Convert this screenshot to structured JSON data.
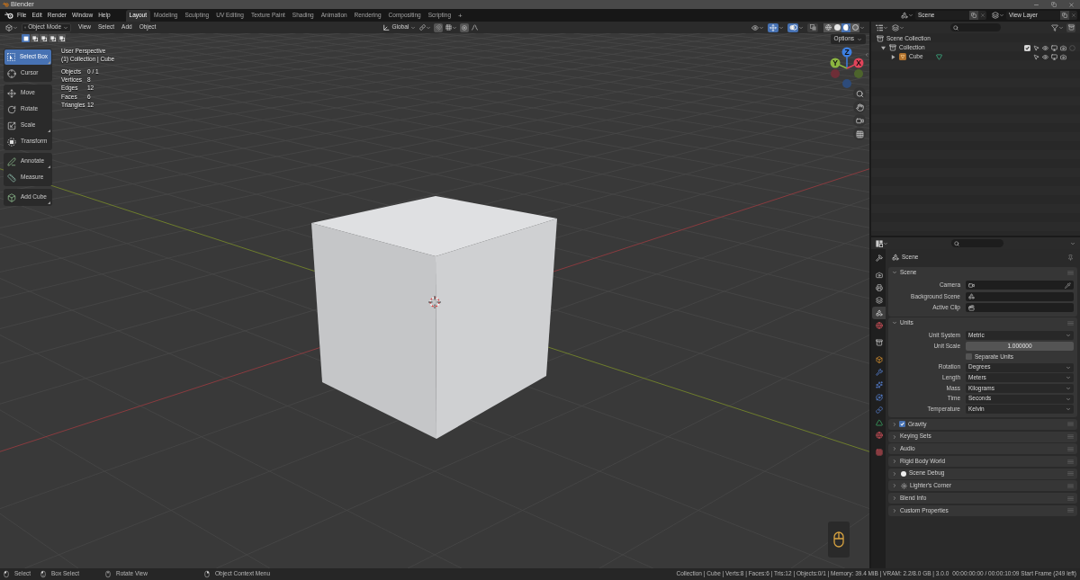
{
  "window": {
    "title": "Blender"
  },
  "topbar": {
    "menu": [
      "File",
      "Edit",
      "Render",
      "Window",
      "Help"
    ],
    "workspaces": [
      {
        "label": "Layout",
        "selected": true
      },
      {
        "label": "Modeling",
        "selected": false
      },
      {
        "label": "Sculpting",
        "selected": false
      },
      {
        "label": "UV Editing",
        "selected": false
      },
      {
        "label": "Texture Paint",
        "selected": false
      },
      {
        "label": "Shading",
        "selected": false
      },
      {
        "label": "Animation",
        "selected": false
      },
      {
        "label": "Rendering",
        "selected": false
      },
      {
        "label": "Compositing",
        "selected": false
      },
      {
        "label": "Scripting",
        "selected": false
      }
    ],
    "add_tab": "+",
    "scene": "Scene",
    "view_layer": "View Layer"
  },
  "viewport": {
    "header": {
      "mode": "Object Mode",
      "menus": [
        "View",
        "Select",
        "Add",
        "Object"
      ],
      "orientation": "Global",
      "toggles": [
        {
          "kind": "gizmo",
          "on": true
        },
        {
          "kind": "overlay",
          "on": true
        },
        {
          "kind": "xray",
          "on": false
        }
      ],
      "shading": [
        {
          "kind": "wireframe",
          "selected": false
        },
        {
          "kind": "solid",
          "selected": false
        },
        {
          "kind": "material",
          "selected": true
        },
        {
          "kind": "rendered",
          "selected": false
        }
      ]
    },
    "select_modes": [
      {
        "kind": "set",
        "selected": true
      },
      {
        "kind": "extend",
        "selected": false
      },
      {
        "kind": "subtract",
        "selected": false
      },
      {
        "kind": "invert",
        "selected": false
      },
      {
        "kind": "intersect",
        "selected": false
      }
    ],
    "options": "Options",
    "tool_groups": [
      {
        "tools": [
          {
            "kind": "select",
            "label": "Select Box",
            "selected": true,
            "more": true
          },
          {
            "kind": "cursor",
            "label": "Cursor",
            "selected": false,
            "more": false
          }
        ]
      },
      {
        "tools": [
          {
            "kind": "move",
            "label": "Move",
            "selected": false,
            "more": false
          },
          {
            "kind": "rotate",
            "label": "Rotate",
            "selected": false,
            "more": false
          },
          {
            "kind": "scale",
            "label": "Scale",
            "selected": false,
            "more": true
          },
          {
            "kind": "transform",
            "label": "Transform",
            "selected": false,
            "more": false
          }
        ]
      },
      {
        "tools": [
          {
            "kind": "annotate",
            "label": "Annotate",
            "selected": false,
            "more": true
          },
          {
            "kind": "measure",
            "label": "Measure",
            "selected": false,
            "more": false
          }
        ]
      },
      {
        "tools": [
          {
            "kind": "add",
            "label": "Add Cube",
            "selected": false,
            "more": true
          }
        ]
      }
    ],
    "view_name": "User Perspective",
    "context": "(1) Collection | Cube",
    "stats": [
      {
        "label": "Objects",
        "value": "0 / 1"
      },
      {
        "label": "Vertices",
        "value": "8"
      },
      {
        "label": "Edges",
        "value": "12"
      },
      {
        "label": "Faces",
        "value": "6"
      },
      {
        "label": "Triangles",
        "value": "12"
      }
    ],
    "gizmo_axes": [
      "Z",
      "Y",
      "X"
    ]
  },
  "outliner": {
    "tree": [
      {
        "kind": "scene_collection",
        "label": "Scene Collection",
        "children": [
          {
            "kind": "collection",
            "label": "Collection",
            "expanded": true,
            "checked": true,
            "children": [
              {
                "kind": "object",
                "label": "Cube",
                "expanded": false
              }
            ]
          }
        ]
      }
    ]
  },
  "properties": {
    "tab_groups": [
      {
        "tabs": [
          {
            "kind": "tool",
            "selected": false
          }
        ]
      },
      {
        "tabs": [
          {
            "kind": "render",
            "selected": false
          },
          {
            "kind": "output",
            "selected": false
          },
          {
            "kind": "view_layer",
            "selected": false
          },
          {
            "kind": "scene",
            "selected": true
          },
          {
            "kind": "world",
            "selected": false
          }
        ]
      },
      {
        "tabs": [
          {
            "kind": "collection",
            "selected": false
          }
        ]
      },
      {
        "tabs": [
          {
            "kind": "object",
            "selected": false
          },
          {
            "kind": "modifiers",
            "selected": false
          },
          {
            "kind": "particles",
            "selected": false
          },
          {
            "kind": "physics",
            "selected": false
          },
          {
            "kind": "constraints",
            "selected": false
          },
          {
            "kind": "data",
            "selected": false
          },
          {
            "kind": "material",
            "selected": false
          }
        ]
      },
      {
        "tabs": [
          {
            "kind": "texture",
            "selected": false
          }
        ]
      }
    ],
    "context": "Scene",
    "panels": [
      {
        "title": "Scene",
        "kind": "plain",
        "expanded": true,
        "rows": [
          {
            "label": "Camera",
            "kind": "camera"
          },
          {
            "label": "Background Scene",
            "kind": "scene"
          },
          {
            "label": "Active Clip",
            "kind": "clip"
          }
        ]
      },
      {
        "title": "Units",
        "kind": "plain",
        "expanded": true,
        "rows": [
          {
            "label": "Unit System",
            "kind": "dropdown",
            "value": "Metric"
          },
          {
            "label": "Unit Scale",
            "kind": "number",
            "value": "1.000000"
          },
          {
            "label": "Separate Units",
            "kind": "checkbox",
            "checked": false
          },
          {
            "label": "Rotation",
            "kind": "dropdown",
            "value": "Degrees"
          },
          {
            "label": "Length",
            "kind": "dropdown",
            "value": "Meters"
          },
          {
            "label": "Mass",
            "kind": "dropdown",
            "value": "Kilograms"
          },
          {
            "label": "Time",
            "kind": "dropdown",
            "value": "Seconds"
          },
          {
            "label": "Temperature",
            "kind": "dropdown",
            "value": "Kelvin"
          }
        ]
      },
      {
        "title": "Gravity",
        "kind": "checkbox",
        "checked": true,
        "expanded": false
      },
      {
        "title": "Keying Sets",
        "kind": "plain",
        "expanded": false
      },
      {
        "title": "Audio",
        "kind": "plain",
        "expanded": false
      },
      {
        "title": "Rigid Body World",
        "kind": "plain",
        "expanded": false
      },
      {
        "title": "Scene Debug",
        "kind": "dot",
        "expanded": false
      },
      {
        "title": "Lighter's Corner",
        "kind": "sun",
        "expanded": false
      },
      {
        "title": "Blend Info",
        "kind": "plain",
        "expanded": false
      },
      {
        "title": "Custom Properties",
        "kind": "plain",
        "expanded": false
      }
    ]
  },
  "status_bar": {
    "hints": [
      {
        "kind": "left",
        "label": "Select"
      },
      {
        "kind": "drag",
        "label": "Box Select"
      },
      {
        "kind": "middle",
        "label": "Rotate View"
      },
      {
        "kind": "right",
        "label": "Object Context Menu"
      }
    ],
    "info": "Collection | Cube | Verts:8 | Faces:6 | Tris:12 | Objects:0/1 | Memory: 39.4 MiB | VRAM: 2.2/8.0 GB | 3.0.0",
    "frame": "00:00:00:00 / 00:00:10:09 Start Frame (249 left)"
  }
}
